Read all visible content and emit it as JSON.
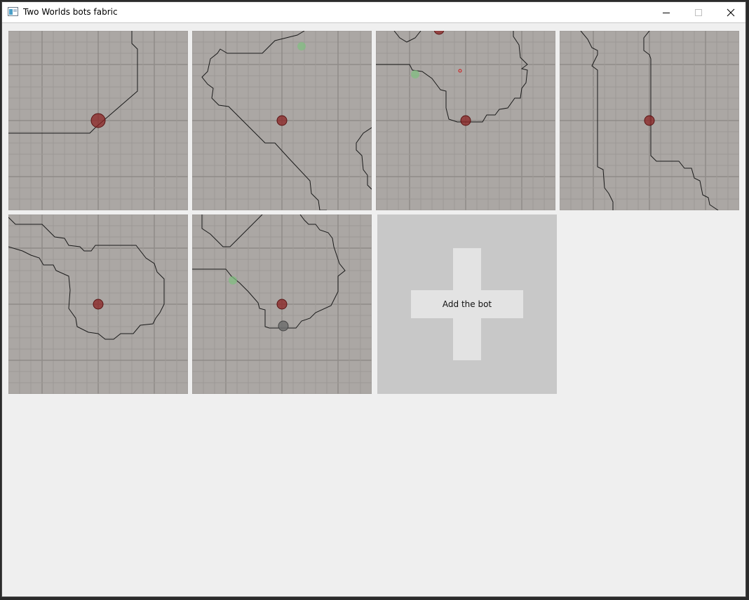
{
  "window": {
    "title": "Two Worlds bots fabric",
    "icon": "app-window-icon",
    "controls": [
      "minimize-icon",
      "maximize-icon",
      "close-icon"
    ]
  },
  "bots_grid": {
    "tile_count": 6,
    "background_color": "#aba7a4",
    "marker_color": "#8b2323",
    "target_color": "#7fbf7f",
    "inactive_color": "#6e6e6e"
  },
  "add_tile": {
    "label": "Add the bot",
    "icon": "plus-icon"
  }
}
